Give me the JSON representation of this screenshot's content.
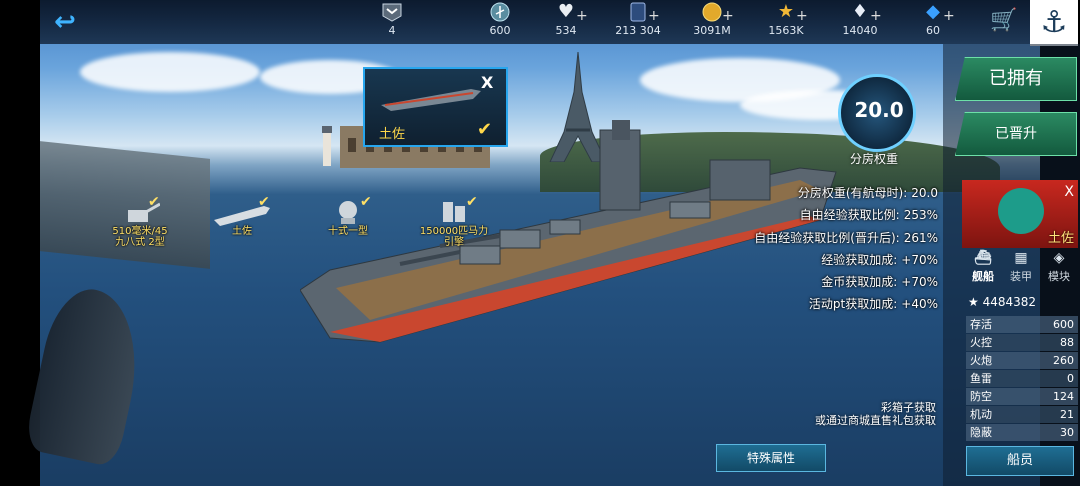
{
  "topbar": {
    "resources": [
      {
        "icon": "rank-emblem-icon",
        "value": "4",
        "plus": false
      },
      {
        "icon": "anchor-coin-icon",
        "value": "600",
        "plus": false
      },
      {
        "icon": "heart-icon",
        "value": "534",
        "plus": true
      },
      {
        "icon": "card-icon",
        "value": "213 304",
        "plus": true
      },
      {
        "icon": "gold-coin-icon",
        "value": "3091M",
        "plus": true
      },
      {
        "icon": "star-icon",
        "value": "1563K",
        "plus": true
      },
      {
        "icon": "diamond-icon",
        "value": "14040",
        "plus": true
      },
      {
        "icon": "blue-gem-icon",
        "value": "60",
        "plus": true
      }
    ]
  },
  "selected_ship": {
    "name": "土佐"
  },
  "equipment": [
    {
      "label_line1": "510毫米/45",
      "label_line2": "九八式 2型",
      "checked": true
    },
    {
      "label_line1": "土佐",
      "label_line2": "",
      "checked": true
    },
    {
      "label_line1": "十式一型",
      "label_line2": "",
      "checked": true
    },
    {
      "label_line1": "150000匹马力",
      "label_line2": "引擎",
      "checked": true
    }
  ],
  "score": {
    "value": "20.0",
    "label": "分房权重"
  },
  "stats": [
    {
      "key": "分房权重(有航母时):",
      "value": "20.0"
    },
    {
      "key": "自由经验获取比例:",
      "value": "253%"
    },
    {
      "key": "自由经验获取比例(晋升后):",
      "value": "261%"
    },
    {
      "key": "经验获取加成:",
      "value": "+70%"
    },
    {
      "key": "金币获取加成:",
      "value": "+70%"
    },
    {
      "key": "活动pt获取加成:",
      "value": "+40%"
    }
  ],
  "obtain_note": {
    "line1": "彩箱子获取",
    "line2": "或通过商城直售礼包获取"
  },
  "special_button": "特殊属性",
  "right_panel": {
    "owned_label": "已拥有",
    "promoted_label": "已晋升",
    "ship_name": "土佐",
    "close": "X",
    "subtabs": [
      "舰船",
      "装甲",
      "模块"
    ],
    "power": "4484382",
    "attributes": [
      {
        "key": "存活",
        "value": "600"
      },
      {
        "key": "火控",
        "value": "88"
      },
      {
        "key": "火炮",
        "value": "260"
      },
      {
        "key": "鱼雷",
        "value": "0"
      },
      {
        "key": "防空",
        "value": "124"
      },
      {
        "key": "机动",
        "value": "21"
      },
      {
        "key": "隐蔽",
        "value": "30"
      }
    ],
    "crew_button": "船员"
  },
  "card_close": "X",
  "colors": {
    "accent_blue": "#27a6ee",
    "check_yellow": "#ffd84a",
    "owned_green": "#2b8a62",
    "flag_red": "#c8281f"
  }
}
